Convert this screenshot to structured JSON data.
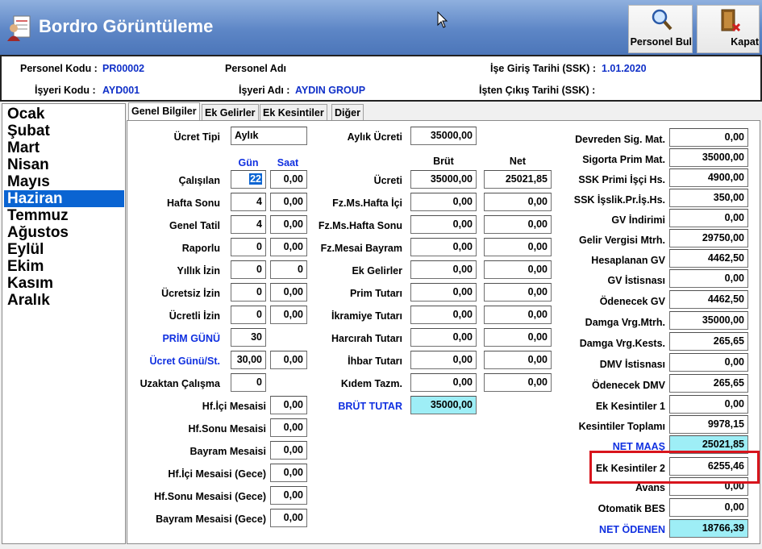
{
  "window": {
    "title": "Bordro Görüntüleme",
    "buttons": [
      {
        "label": "Personel Bul",
        "icon": "magnifier-icon"
      },
      {
        "label": "Kapat",
        "icon": "door-exit-icon"
      }
    ]
  },
  "header": {
    "personel_kodu_label": "Personel Kodu :",
    "personel_kodu": "PR00002",
    "personel_adi_label": "Personel Adı",
    "ise_giris_label": "İşe Giriş Tarihi (SSK) :",
    "ise_giris": "1.01.2020",
    "isyeri_kodu_label": "İşyeri Kodu :",
    "isyeri_kodu": "AYD001",
    "isyeri_adi_label": "İşyeri Adı :",
    "isyeri_adi": "AYDIN GROUP",
    "isten_cikis_label": "İşten Çıkış Tarihi (SSK) :"
  },
  "months": [
    "Ocak",
    "Şubat",
    "Mart",
    "Nisan",
    "Mayıs",
    "Haziran",
    "Temmuz",
    "Ağustos",
    "Eylül",
    "Ekim",
    "Kasım",
    "Aralık"
  ],
  "selected_month": "Haziran",
  "tabs": [
    "Genel Bilgiler",
    "Ek Gelirler",
    "Ek Kesintiler",
    "Diğer"
  ],
  "active_tab": "Genel Bilgiler",
  "left": {
    "ucret_tipi_label": "Ücret Tipi",
    "ucret_tipi": "Aylık",
    "gun_header": "Gün",
    "saat_header": "Saat",
    "rows": [
      {
        "label": "Çalışılan",
        "gun": "22",
        "saat": "0,00"
      },
      {
        "label": "Hafta Sonu",
        "gun": "4",
        "saat": "0,00"
      },
      {
        "label": "Genel Tatil",
        "gun": "4",
        "saat": "0,00"
      },
      {
        "label": "Raporlu",
        "gun": "0",
        "saat": "0,00"
      },
      {
        "label": "Yıllık İzin",
        "gun": "0",
        "saat": "0"
      },
      {
        "label": "Ücretsiz İzin",
        "gun": "0",
        "saat": "0,00"
      },
      {
        "label": "Ücretli İzin",
        "gun": "0",
        "saat": "0,00"
      }
    ],
    "prim_gunu_label": "PRİM GÜNÜ",
    "prim_gunu": "30",
    "ucret_gunu_label": "Ücret Günü/St.",
    "ucret_gunu": "30,00",
    "ucret_gunu_saat": "0,00",
    "uzaktan_label": "Uzaktan Çalışma",
    "uzaktan": "0",
    "mesai": [
      {
        "label": "Hf.İçi Mesaisi",
        "value": "0,00"
      },
      {
        "label": "Hf.Sonu Mesaisi",
        "value": "0,00"
      },
      {
        "label": "Bayram Mesaisi",
        "value": "0,00"
      },
      {
        "label": "Hf.İçi Mesaisi (Gece)",
        "value": "0,00"
      },
      {
        "label": "Hf.Sonu Mesaisi (Gece)",
        "value": "0,00"
      },
      {
        "label": "Bayram Mesaisi (Gece)",
        "value": "0,00"
      }
    ]
  },
  "middle": {
    "aylik_ucreti_label": "Aylık Ücreti",
    "aylik_ucreti": "35000,00",
    "brut_header": "Brüt",
    "net_header": "Net",
    "rows": [
      {
        "label": "Ücreti",
        "brut": "35000,00",
        "net": "25021,85"
      },
      {
        "label": "Fz.Ms.Hafta İçi",
        "brut": "0,00",
        "net": "0,00"
      },
      {
        "label": "Fz.Ms.Hafta Sonu",
        "brut": "0,00",
        "net": "0,00"
      },
      {
        "label": "Fz.Mesai Bayram",
        "brut": "0,00",
        "net": "0,00"
      },
      {
        "label": "Ek Gelirler",
        "brut": "0,00",
        "net": "0,00"
      },
      {
        "label": "Prim Tutarı",
        "brut": "0,00",
        "net": "0,00"
      },
      {
        "label": "İkramiye Tutarı",
        "brut": "0,00",
        "net": "0,00"
      },
      {
        "label": "Harcırah Tutarı",
        "brut": "0,00",
        "net": "0,00"
      },
      {
        "label": "İhbar Tutarı",
        "brut": "0,00",
        "net": "0,00"
      },
      {
        "label": "Kıdem Tazm.",
        "brut": "0,00",
        "net": "0,00"
      }
    ],
    "brut_tutar_label": "BRÜT TUTAR",
    "brut_tutar": "35000,00"
  },
  "right": {
    "rows": [
      {
        "label": "Devreden Sig. Mat.",
        "value": "0,00"
      },
      {
        "label": "Sigorta Prim Mat.",
        "value": "35000,00"
      },
      {
        "label": "SSK Primi İşçi Hs.",
        "value": "4900,00"
      },
      {
        "label": "SSK İşslik.Pr.İş.Hs.",
        "value": "350,00"
      },
      {
        "label": "GV İndirimi",
        "value": "0,00"
      },
      {
        "label": "Gelir Vergisi Mtrh.",
        "value": "29750,00"
      },
      {
        "label": "Hesaplanan GV",
        "value": "4462,50"
      },
      {
        "label": "GV İstisnası",
        "value": "0,00"
      },
      {
        "label": "Ödenecek GV",
        "value": "4462,50"
      },
      {
        "label": "Damga Vrg.Mtrh.",
        "value": "35000,00"
      },
      {
        "label": "Damga Vrg.Kests.",
        "value": "265,65"
      },
      {
        "label": "DMV İstisnası",
        "value": "0,00"
      },
      {
        "label": "Ödenecek DMV",
        "value": "265,65"
      },
      {
        "label": "Ek Kesintiler 1",
        "value": "0,00"
      },
      {
        "label": "Kesintiler Toplamı",
        "value": "9978,15"
      }
    ],
    "net_maas_label": "NET MAAŞ",
    "net_maas": "25021,85",
    "ek_kesintiler2_label": "Ek Kesintiler 2",
    "ek_kesintiler2": "6255,46",
    "avans_label": "Avans",
    "avans": "0,00",
    "otomatik_bes_label": "Otomatik BES",
    "otomatik_bes": "0,00",
    "net_odenen_label": "NET ÖDENEN",
    "net_odenen": "18766,39"
  },
  "colors": {
    "title_blue": "#5d86c6",
    "selection": "#0a64d2",
    "label_blue": "#1030e0",
    "highlight_cyan": "#9eeef6",
    "annotation_red": "#d8141c"
  }
}
